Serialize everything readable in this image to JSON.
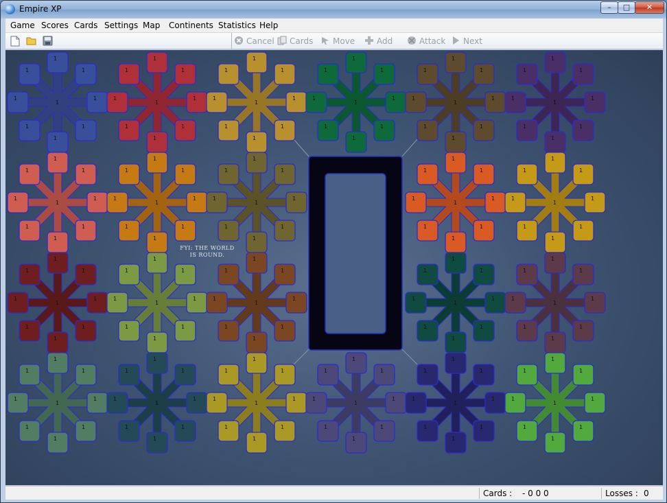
{
  "window": {
    "title": "Empire XP",
    "min": "–",
    "max": "□",
    "close": "✕"
  },
  "menu": [
    "Game",
    "Scores",
    "Cards",
    "Settings",
    "Map",
    "Continents",
    "Statistics",
    "Help"
  ],
  "toolbar": {
    "left_icons": [
      "new-file-icon",
      "open-folder-icon",
      "save-disk-icon"
    ],
    "actions": [
      {
        "label": "Cancel",
        "icon": "cancel-icon",
        "enabled": false
      },
      {
        "label": "Cards",
        "icon": "cards-icon",
        "enabled": false
      },
      {
        "label": "Move",
        "icon": "move-icon",
        "enabled": false
      },
      {
        "label": "Add",
        "icon": "add-icon",
        "enabled": false
      },
      {
        "label": "Attack",
        "icon": "attack-icon",
        "enabled": false
      },
      {
        "label": "Next",
        "icon": "next-icon",
        "enabled": false
      }
    ]
  },
  "board": {
    "fyi_line1": "FYI: THE WORLD",
    "fyi_line2": "IS ROUND.",
    "territory_value": "1",
    "continents": [
      [
        "#3a4f9a",
        "#b0303a",
        "#b8902e",
        "#0e6a3a",
        "#5e4a2c",
        "#4a2e66"
      ],
      [
        "#cf5d52",
        "#c67a14",
        "#6f6530",
        null,
        "#da5a23",
        "#c59a16"
      ],
      [
        "#6e1e1e",
        "#7c9a44",
        "#7a4722",
        null,
        "#0f4b40",
        "#5c3a4a"
      ],
      [
        "#537d63",
        "#234a56",
        "#ab9925",
        "#4c4878",
        "#27286e",
        "#52aa3e"
      ]
    ]
  },
  "status": {
    "cards_label": "Cards :",
    "cards_value": "- 0 0 0",
    "losses_label": "Losses :",
    "losses_value": "0"
  }
}
